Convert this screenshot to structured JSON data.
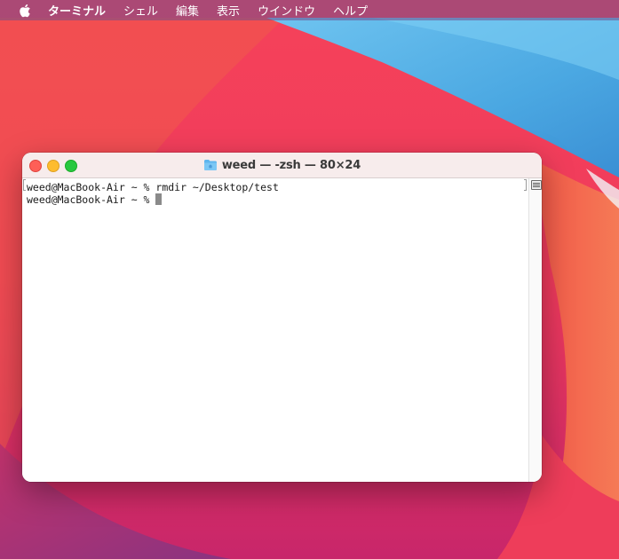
{
  "menubar": {
    "app_name": "ターミナル",
    "items": [
      {
        "label": "シェル"
      },
      {
        "label": "編集"
      },
      {
        "label": "表示"
      },
      {
        "label": "ウインドウ"
      },
      {
        "label": "ヘルプ"
      }
    ]
  },
  "window": {
    "title": "weed — -zsh — 80×24",
    "lines": [
      "weed@MacBook-Air ~ % rmdir ~/Desktop/test",
      "weed@MacBook-Air ~ % "
    ]
  },
  "icons": {
    "apple": "apple-logo-icon",
    "folder": "home-folder-icon",
    "marks": "marks-list-icon"
  },
  "colors": {
    "close": "#fe5f57",
    "minimize": "#febc2e",
    "maximize": "#28c840",
    "titlebar": "#f7ecec",
    "menubar": "#6e508c"
  }
}
